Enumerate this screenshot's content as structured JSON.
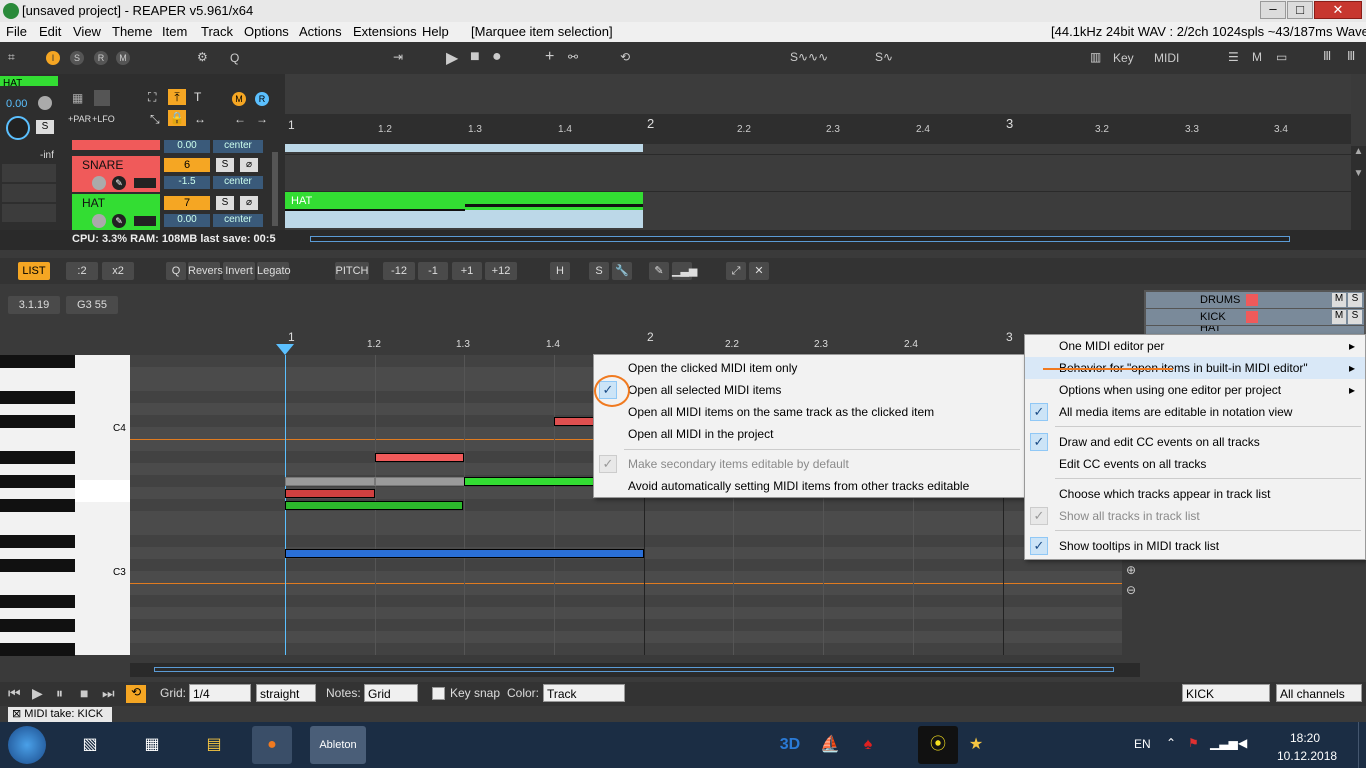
{
  "window": {
    "title": "[unsaved project] - REAPER v5.961/x64",
    "status": "[44.1kHz 24bit WAV : 2/2ch 1024spls ~43/187ms WaveOut]",
    "min_icon": "minimize-icon",
    "max_icon": "maximize-icon",
    "close_icon": "close-icon"
  },
  "menubar": {
    "items": [
      "File",
      "Edit",
      "View",
      "Theme",
      "Item",
      "Track",
      "Options",
      "Actions",
      "Extensions",
      "Help"
    ],
    "mode": "[Marquee item selection]"
  },
  "toolbar": {
    "key_label": "Key",
    "midi_label": "MIDI",
    "q_label": "Q",
    "icons": [
      "metronome-icon",
      "play-icon",
      "stop-icon",
      "record-icon",
      "add-icon"
    ]
  },
  "tracks": {
    "master_label": "HAT",
    "master_vol": "0.00",
    "master_s": "S",
    "master_inf": "-inf",
    "fx_labels": [
      "+PAR",
      "+LFO"
    ],
    "items": [
      {
        "name": "SNARE",
        "number": "6",
        "vol": "-1.5",
        "pan": "center",
        "s": "S"
      },
      {
        "name": "HAT",
        "number": "7",
        "vol": "0.00",
        "pan": "center",
        "s": "S"
      }
    ],
    "top_vol": "0.00",
    "top_pan": "center"
  },
  "timeline": {
    "labels": [
      "1",
      "1.2",
      "1.3",
      "1.4",
      "2",
      "2.2",
      "2.3",
      "2.4",
      "3",
      "3.2",
      "3.3",
      "3.4"
    ],
    "item_label": "HAT"
  },
  "status": {
    "cpu": "CPU: 3.3%  RAM: 108MB  last save: 00:5"
  },
  "midi_toolbar": {
    "list": "LIST",
    "div2": ":2",
    "x2": "x2",
    "q": "Q",
    "revers": "Revers",
    "invert": "Invert",
    "legato": "Legato",
    "pitch": "PITCH",
    "pitch_buttons": [
      "-12",
      "-1",
      "+1",
      "+12"
    ],
    "h": "H",
    "s": "S"
  },
  "midi_info": {
    "position": "3.1.19",
    "note": "G3  55"
  },
  "midi_ruler": [
    "1",
    "1.2",
    "1.3",
    "1.4",
    "2",
    "2.2",
    "2.3",
    "2.4",
    "3"
  ],
  "piano": {
    "c4": "C4",
    "c3": "C3"
  },
  "track_list": [
    {
      "name": "DRUMS"
    },
    {
      "name": "KICK"
    },
    {
      "name": "HAT"
    }
  ],
  "context_menu_left": {
    "items": [
      {
        "label": "Open the clicked MIDI item only",
        "checked": false,
        "disabled": false
      },
      {
        "label": "Open all selected MIDI items",
        "checked": true,
        "disabled": false
      },
      {
        "label": "Open all MIDI items on the same track as the clicked item",
        "checked": false,
        "disabled": false
      },
      {
        "label": "Open all MIDI in the project",
        "checked": false,
        "disabled": false
      },
      {
        "label": "Make secondary items editable by default",
        "checked": true,
        "disabled": true
      },
      {
        "label": "Avoid automatically setting MIDI items from other tracks editable",
        "checked": false,
        "disabled": false
      }
    ]
  },
  "context_menu_right": {
    "items": [
      {
        "label": "One MIDI editor per",
        "checked": false,
        "submenu": true
      },
      {
        "label": "Behavior for \"open items in built-in MIDI editor\"",
        "checked": false,
        "submenu": true
      },
      {
        "label": "Options when using one editor per project",
        "checked": false,
        "submenu": true
      },
      {
        "label": "All media items are editable in notation view",
        "checked": true
      },
      {
        "label": "Draw and edit CC events on all tracks",
        "checked": true
      },
      {
        "label": "Edit CC events on all tracks",
        "checked": false
      },
      {
        "label": "Choose which tracks appear in track list",
        "checked": false
      },
      {
        "label": "Show all tracks in track list",
        "checked": true,
        "disabled": true
      },
      {
        "label": "Show tooltips in MIDI track list",
        "checked": true
      }
    ]
  },
  "bottom": {
    "grid_label": "Grid:",
    "grid_value": "1/4",
    "straight": "straight",
    "notes_label": "Notes:",
    "notes_value": "Grid",
    "key_snap": "Key snap",
    "color_label": "Color:",
    "color_value": "Track",
    "track_value": "KICK",
    "channels_value": "All channels",
    "midi_take": "MIDI take: KICK"
  },
  "taskbar": {
    "lang": "EN",
    "time": "18:20",
    "date": "10.12.2018",
    "app_label": "Ableton"
  },
  "colors": {
    "accent_orange": "#f5a623",
    "snare_red": "#f05a5a",
    "hat_green": "#33dd33",
    "note_blue": "#2a6fd6",
    "item_blue": "#bcd8e8"
  }
}
